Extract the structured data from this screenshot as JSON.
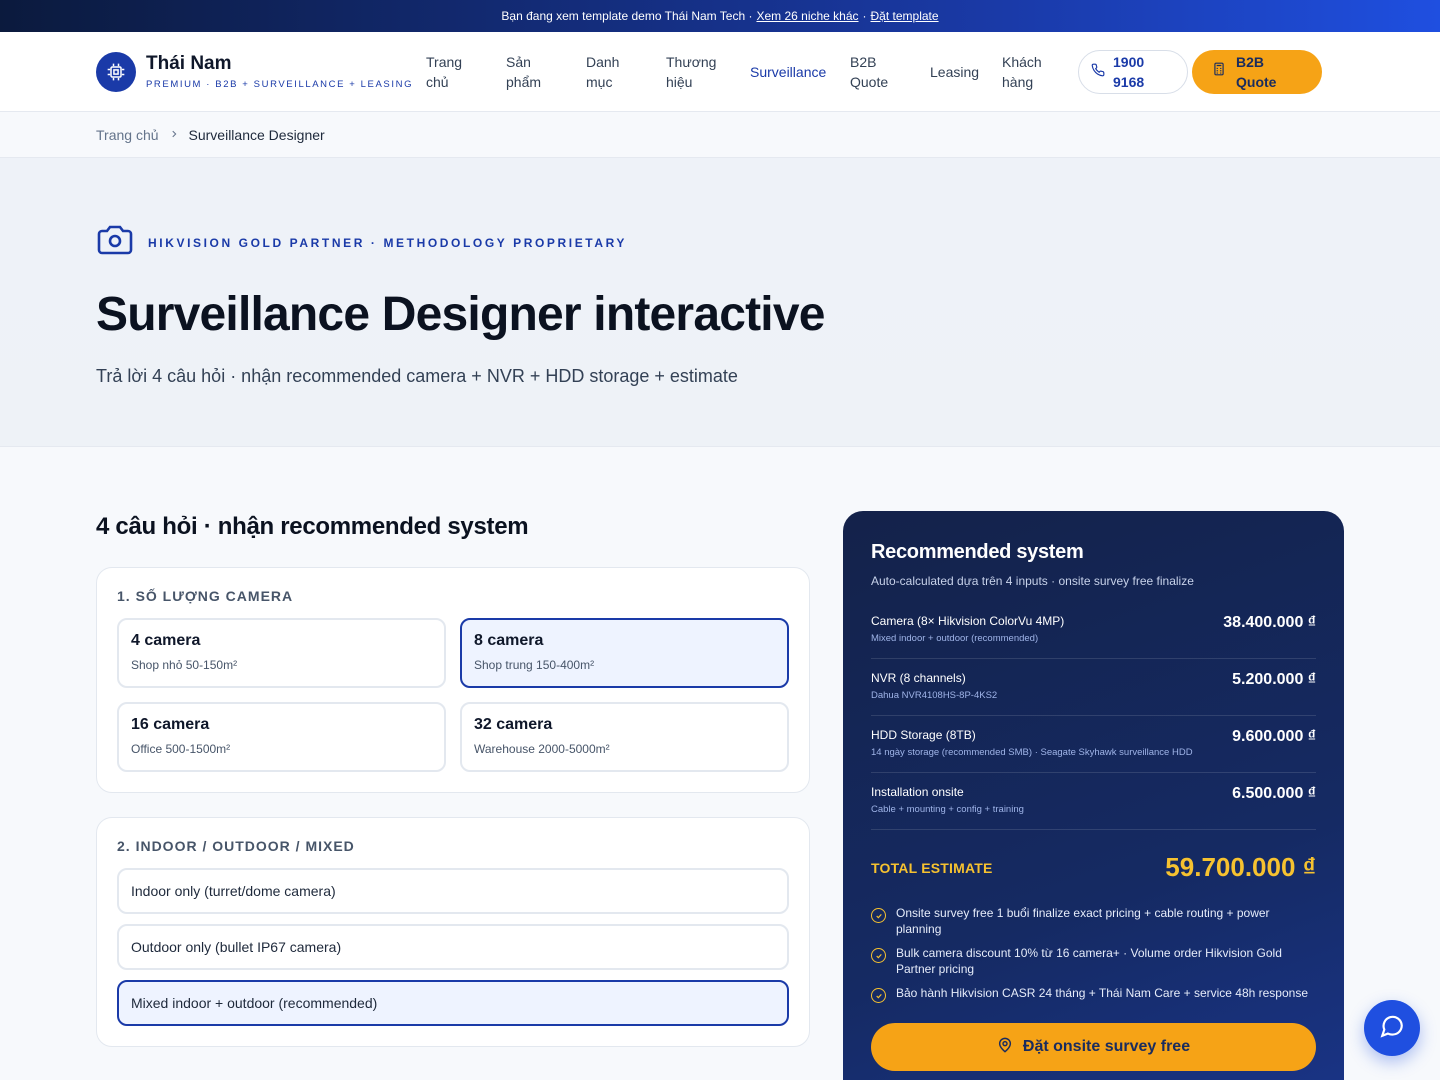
{
  "banner": {
    "text": "Bạn đang xem template demo Thái Nam Tech ·",
    "link1": "Xem 26 niche khác",
    "sep": "·",
    "link2": "Đặt template"
  },
  "header": {
    "brand_name": "Thái Nam",
    "brand_tagline": "PREMIUM · B2B + SURVEILLANCE + LEASING",
    "nav": [
      {
        "label": "Trang chủ"
      },
      {
        "label": "Sản phẩm"
      },
      {
        "label": "Danh mục"
      },
      {
        "label": "Thương hiệu"
      },
      {
        "label": "Surveillance"
      },
      {
        "label": "B2B Quote"
      },
      {
        "label": "Leasing"
      },
      {
        "label": "Khách hàng"
      }
    ],
    "phone_label": "1900 9168",
    "quote_label": "B2B Quote"
  },
  "breadcrumb": {
    "home": "Trang chủ",
    "current": "Surveillance Designer"
  },
  "hero": {
    "eyebrow": "HIKVISION GOLD PARTNER · METHODOLOGY PROPRIETARY",
    "title": "Surveillance Designer interactive",
    "subtitle": "Trả lời 4 câu hỏi · nhận recommended camera + NVR + HDD storage + estimate"
  },
  "questions": {
    "section_title": "4 câu hỏi · nhận recommended system",
    "q1": {
      "label": "1. SỐ LƯỢNG CAMERA",
      "options": [
        {
          "title": "4 camera",
          "sub": "Shop nhỏ 50-150m²"
        },
        {
          "title": "8 camera",
          "sub": "Shop trung 150-400m²"
        },
        {
          "title": "16 camera",
          "sub": "Office 500-1500m²"
        },
        {
          "title": "32 camera",
          "sub": "Warehouse 2000-5000m²"
        }
      ],
      "selected": "8 camera"
    },
    "q2": {
      "label": "2. INDOOR / OUTDOOR / MIXED",
      "options": [
        {
          "title": "Indoor only (turret/dome camera)"
        },
        {
          "title": "Outdoor only (bullet IP67 camera)"
        },
        {
          "title": "Mixed indoor + outdoor (recommended)"
        }
      ],
      "selected": "Mixed indoor + outdoor (recommended)"
    }
  },
  "panel": {
    "title": "Recommended system",
    "subtitle": "Auto-calculated dựa trên 4 inputs · onsite survey free finalize",
    "items": [
      {
        "name": "Camera (8× Hikvision ColorVu 4MP)",
        "note": "Mixed indoor + outdoor (recommended)",
        "price": "38.400.000 ₫"
      },
      {
        "name": "NVR (8 channels)",
        "note": "Dahua NVR4108HS-8P-4KS2",
        "price": "5.200.000 ₫"
      },
      {
        "name": "HDD Storage (8TB)",
        "note": "14 ngày storage (recommended SMB) · Seagate Skyhawk surveillance HDD",
        "price": "9.600.000 ₫"
      },
      {
        "name": "Installation onsite",
        "note": "Cable + mounting + config + training",
        "price": "6.500.000 ₫"
      }
    ],
    "total_label": "TOTAL ESTIMATE",
    "total_value": "59.700.000 ₫",
    "benefits": [
      "Onsite survey free 1 buổi finalize exact pricing + cable routing + power planning",
      "Bulk camera discount 10% từ 16 camera+ · Volume order Hikvision Gold Partner pricing",
      "Bảo hành Hikvision CASR 24 tháng + Thái Nam Care + service 48h response"
    ],
    "cta_label": "Đặt onsite survey free"
  },
  "colors": {
    "primary": "#1a3aa8",
    "accent": "#f6a316",
    "total": "#f6c230",
    "panel_bg": "#152a63"
  },
  "icons": [
    "chip-icon",
    "phone-icon",
    "calculator-icon",
    "chevron-right-icon",
    "camera-icon",
    "check-circle-icon",
    "map-pin-icon",
    "chat-icon"
  ]
}
